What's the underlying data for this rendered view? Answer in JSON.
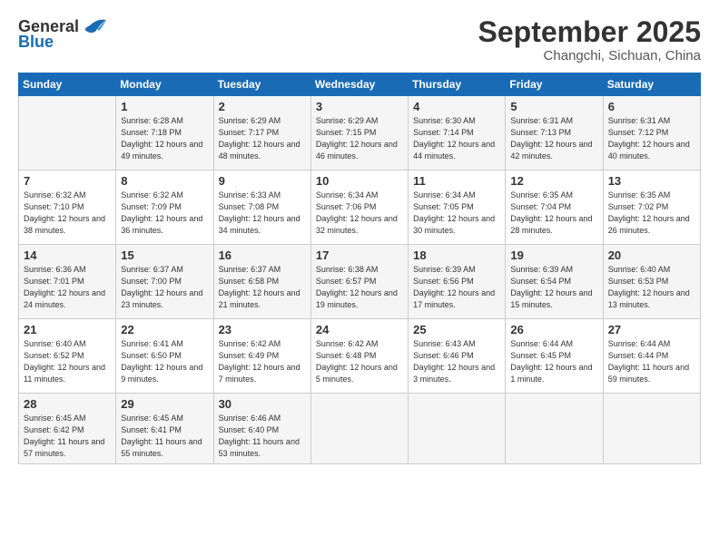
{
  "logo": {
    "line1": "General",
    "line2": "Blue"
  },
  "title": "September 2025",
  "location": "Changchi, Sichuan, China",
  "days_of_week": [
    "Sunday",
    "Monday",
    "Tuesday",
    "Wednesday",
    "Thursday",
    "Friday",
    "Saturday"
  ],
  "weeks": [
    [
      {
        "day": "",
        "empty": true
      },
      {
        "day": "1",
        "sunrise": "Sunrise: 6:28 AM",
        "sunset": "Sunset: 7:18 PM",
        "daylight": "Daylight: 12 hours and 49 minutes."
      },
      {
        "day": "2",
        "sunrise": "Sunrise: 6:29 AM",
        "sunset": "Sunset: 7:17 PM",
        "daylight": "Daylight: 12 hours and 48 minutes."
      },
      {
        "day": "3",
        "sunrise": "Sunrise: 6:29 AM",
        "sunset": "Sunset: 7:15 PM",
        "daylight": "Daylight: 12 hours and 46 minutes."
      },
      {
        "day": "4",
        "sunrise": "Sunrise: 6:30 AM",
        "sunset": "Sunset: 7:14 PM",
        "daylight": "Daylight: 12 hours and 44 minutes."
      },
      {
        "day": "5",
        "sunrise": "Sunrise: 6:31 AM",
        "sunset": "Sunset: 7:13 PM",
        "daylight": "Daylight: 12 hours and 42 minutes."
      },
      {
        "day": "6",
        "sunrise": "Sunrise: 6:31 AM",
        "sunset": "Sunset: 7:12 PM",
        "daylight": "Daylight: 12 hours and 40 minutes."
      }
    ],
    [
      {
        "day": "7",
        "sunrise": "Sunrise: 6:32 AM",
        "sunset": "Sunset: 7:10 PM",
        "daylight": "Daylight: 12 hours and 38 minutes."
      },
      {
        "day": "8",
        "sunrise": "Sunrise: 6:32 AM",
        "sunset": "Sunset: 7:09 PM",
        "daylight": "Daylight: 12 hours and 36 minutes."
      },
      {
        "day": "9",
        "sunrise": "Sunrise: 6:33 AM",
        "sunset": "Sunset: 7:08 PM",
        "daylight": "Daylight: 12 hours and 34 minutes."
      },
      {
        "day": "10",
        "sunrise": "Sunrise: 6:34 AM",
        "sunset": "Sunset: 7:06 PM",
        "daylight": "Daylight: 12 hours and 32 minutes."
      },
      {
        "day": "11",
        "sunrise": "Sunrise: 6:34 AM",
        "sunset": "Sunset: 7:05 PM",
        "daylight": "Daylight: 12 hours and 30 minutes."
      },
      {
        "day": "12",
        "sunrise": "Sunrise: 6:35 AM",
        "sunset": "Sunset: 7:04 PM",
        "daylight": "Daylight: 12 hours and 28 minutes."
      },
      {
        "day": "13",
        "sunrise": "Sunrise: 6:35 AM",
        "sunset": "Sunset: 7:02 PM",
        "daylight": "Daylight: 12 hours and 26 minutes."
      }
    ],
    [
      {
        "day": "14",
        "sunrise": "Sunrise: 6:36 AM",
        "sunset": "Sunset: 7:01 PM",
        "daylight": "Daylight: 12 hours and 24 minutes."
      },
      {
        "day": "15",
        "sunrise": "Sunrise: 6:37 AM",
        "sunset": "Sunset: 7:00 PM",
        "daylight": "Daylight: 12 hours and 23 minutes."
      },
      {
        "day": "16",
        "sunrise": "Sunrise: 6:37 AM",
        "sunset": "Sunset: 6:58 PM",
        "daylight": "Daylight: 12 hours and 21 minutes."
      },
      {
        "day": "17",
        "sunrise": "Sunrise: 6:38 AM",
        "sunset": "Sunset: 6:57 PM",
        "daylight": "Daylight: 12 hours and 19 minutes."
      },
      {
        "day": "18",
        "sunrise": "Sunrise: 6:39 AM",
        "sunset": "Sunset: 6:56 PM",
        "daylight": "Daylight: 12 hours and 17 minutes."
      },
      {
        "day": "19",
        "sunrise": "Sunrise: 6:39 AM",
        "sunset": "Sunset: 6:54 PM",
        "daylight": "Daylight: 12 hours and 15 minutes."
      },
      {
        "day": "20",
        "sunrise": "Sunrise: 6:40 AM",
        "sunset": "Sunset: 6:53 PM",
        "daylight": "Daylight: 12 hours and 13 minutes."
      }
    ],
    [
      {
        "day": "21",
        "sunrise": "Sunrise: 6:40 AM",
        "sunset": "Sunset: 6:52 PM",
        "daylight": "Daylight: 12 hours and 11 minutes."
      },
      {
        "day": "22",
        "sunrise": "Sunrise: 6:41 AM",
        "sunset": "Sunset: 6:50 PM",
        "daylight": "Daylight: 12 hours and 9 minutes."
      },
      {
        "day": "23",
        "sunrise": "Sunrise: 6:42 AM",
        "sunset": "Sunset: 6:49 PM",
        "daylight": "Daylight: 12 hours and 7 minutes."
      },
      {
        "day": "24",
        "sunrise": "Sunrise: 6:42 AM",
        "sunset": "Sunset: 6:48 PM",
        "daylight": "Daylight: 12 hours and 5 minutes."
      },
      {
        "day": "25",
        "sunrise": "Sunrise: 6:43 AM",
        "sunset": "Sunset: 6:46 PM",
        "daylight": "Daylight: 12 hours and 3 minutes."
      },
      {
        "day": "26",
        "sunrise": "Sunrise: 6:44 AM",
        "sunset": "Sunset: 6:45 PM",
        "daylight": "Daylight: 12 hours and 1 minute."
      },
      {
        "day": "27",
        "sunrise": "Sunrise: 6:44 AM",
        "sunset": "Sunset: 6:44 PM",
        "daylight": "Daylight: 11 hours and 59 minutes."
      }
    ],
    [
      {
        "day": "28",
        "sunrise": "Sunrise: 6:45 AM",
        "sunset": "Sunset: 6:42 PM",
        "daylight": "Daylight: 11 hours and 57 minutes."
      },
      {
        "day": "29",
        "sunrise": "Sunrise: 6:45 AM",
        "sunset": "Sunset: 6:41 PM",
        "daylight": "Daylight: 11 hours and 55 minutes."
      },
      {
        "day": "30",
        "sunrise": "Sunrise: 6:46 AM",
        "sunset": "Sunset: 6:40 PM",
        "daylight": "Daylight: 11 hours and 53 minutes."
      },
      {
        "day": "",
        "empty": true
      },
      {
        "day": "",
        "empty": true
      },
      {
        "day": "",
        "empty": true
      },
      {
        "day": "",
        "empty": true
      }
    ]
  ]
}
